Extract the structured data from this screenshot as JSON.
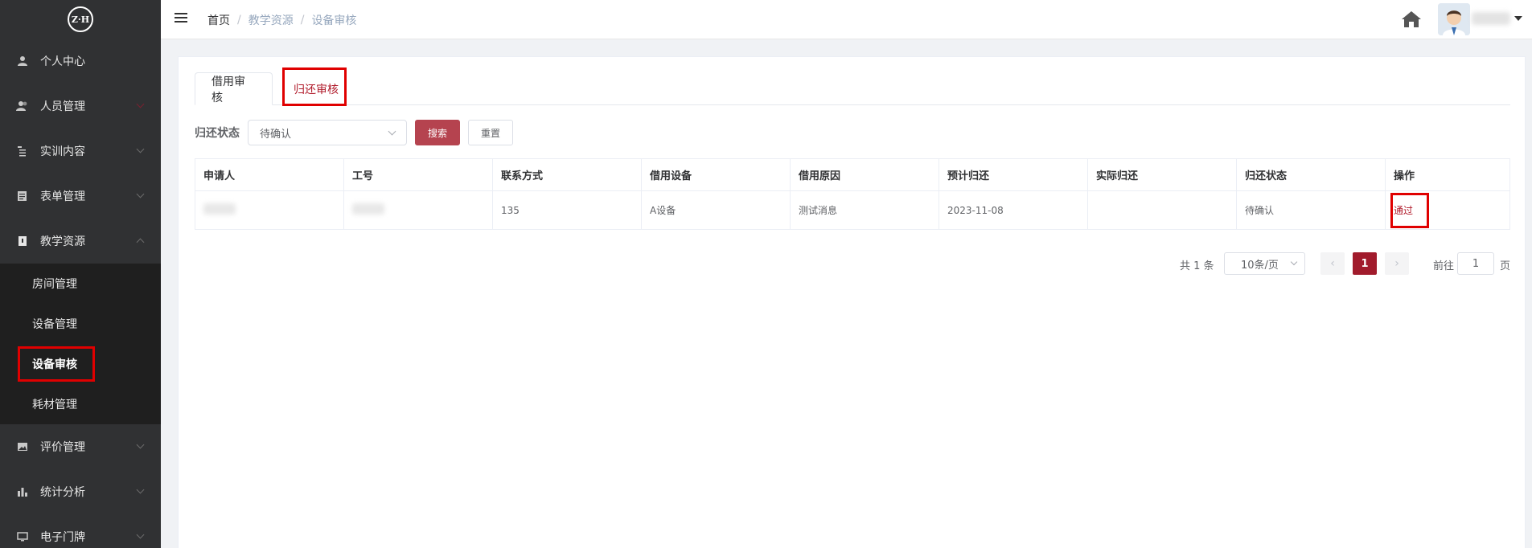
{
  "sidebar": {
    "logo_text": "Z·H",
    "items": [
      {
        "label": "个人中心",
        "icon": "user-icon"
      },
      {
        "label": "人员管理",
        "icon": "users-icon"
      },
      {
        "label": "实训内容",
        "icon": "list-icon"
      },
      {
        "label": "表单管理",
        "icon": "form-icon"
      },
      {
        "label": "教学资源",
        "icon": "book-icon"
      },
      {
        "label": "评价管理",
        "icon": "image-icon"
      },
      {
        "label": "统计分析",
        "icon": "bar-chart-icon"
      },
      {
        "label": "电子门牌",
        "icon": "monitor-icon"
      }
    ],
    "submenu": [
      {
        "label": "房间管理"
      },
      {
        "label": "设备管理"
      },
      {
        "label": "设备审核"
      },
      {
        "label": "耗材管理"
      }
    ]
  },
  "header": {
    "breadcrumb": {
      "home": "首页",
      "sep1": "/",
      "level1": "教学资源",
      "sep2": "/",
      "level2": "设备审核"
    }
  },
  "tabs": [
    {
      "label": "借用审核"
    },
    {
      "label": "归还审核"
    }
  ],
  "filter": {
    "label": "归还状态",
    "status_value": "待确认",
    "search_label": "搜索",
    "reset_label": "重置"
  },
  "table": {
    "headers": [
      "申请人",
      "工号",
      "联系方式",
      "借用设备",
      "借用原因",
      "预计归还",
      "实际归还",
      "归还状态",
      "操作"
    ],
    "rows": [
      {
        "contact": "135",
        "device": "A设备",
        "reason": "测试消息",
        "expected": "2023-11-08",
        "actual": "",
        "status": "待确认",
        "action": "通过"
      }
    ]
  },
  "pagination": {
    "total": "共 1 条",
    "page_size": "10条/页",
    "current": "1",
    "goto_label": "前往",
    "goto_value": "1",
    "page_suffix": "页"
  },
  "colors": {
    "accent": "#a11b2c",
    "sidebar_bg": "#303133",
    "submenu_bg": "#1f1f1f",
    "highlight_box": "#e00000"
  }
}
